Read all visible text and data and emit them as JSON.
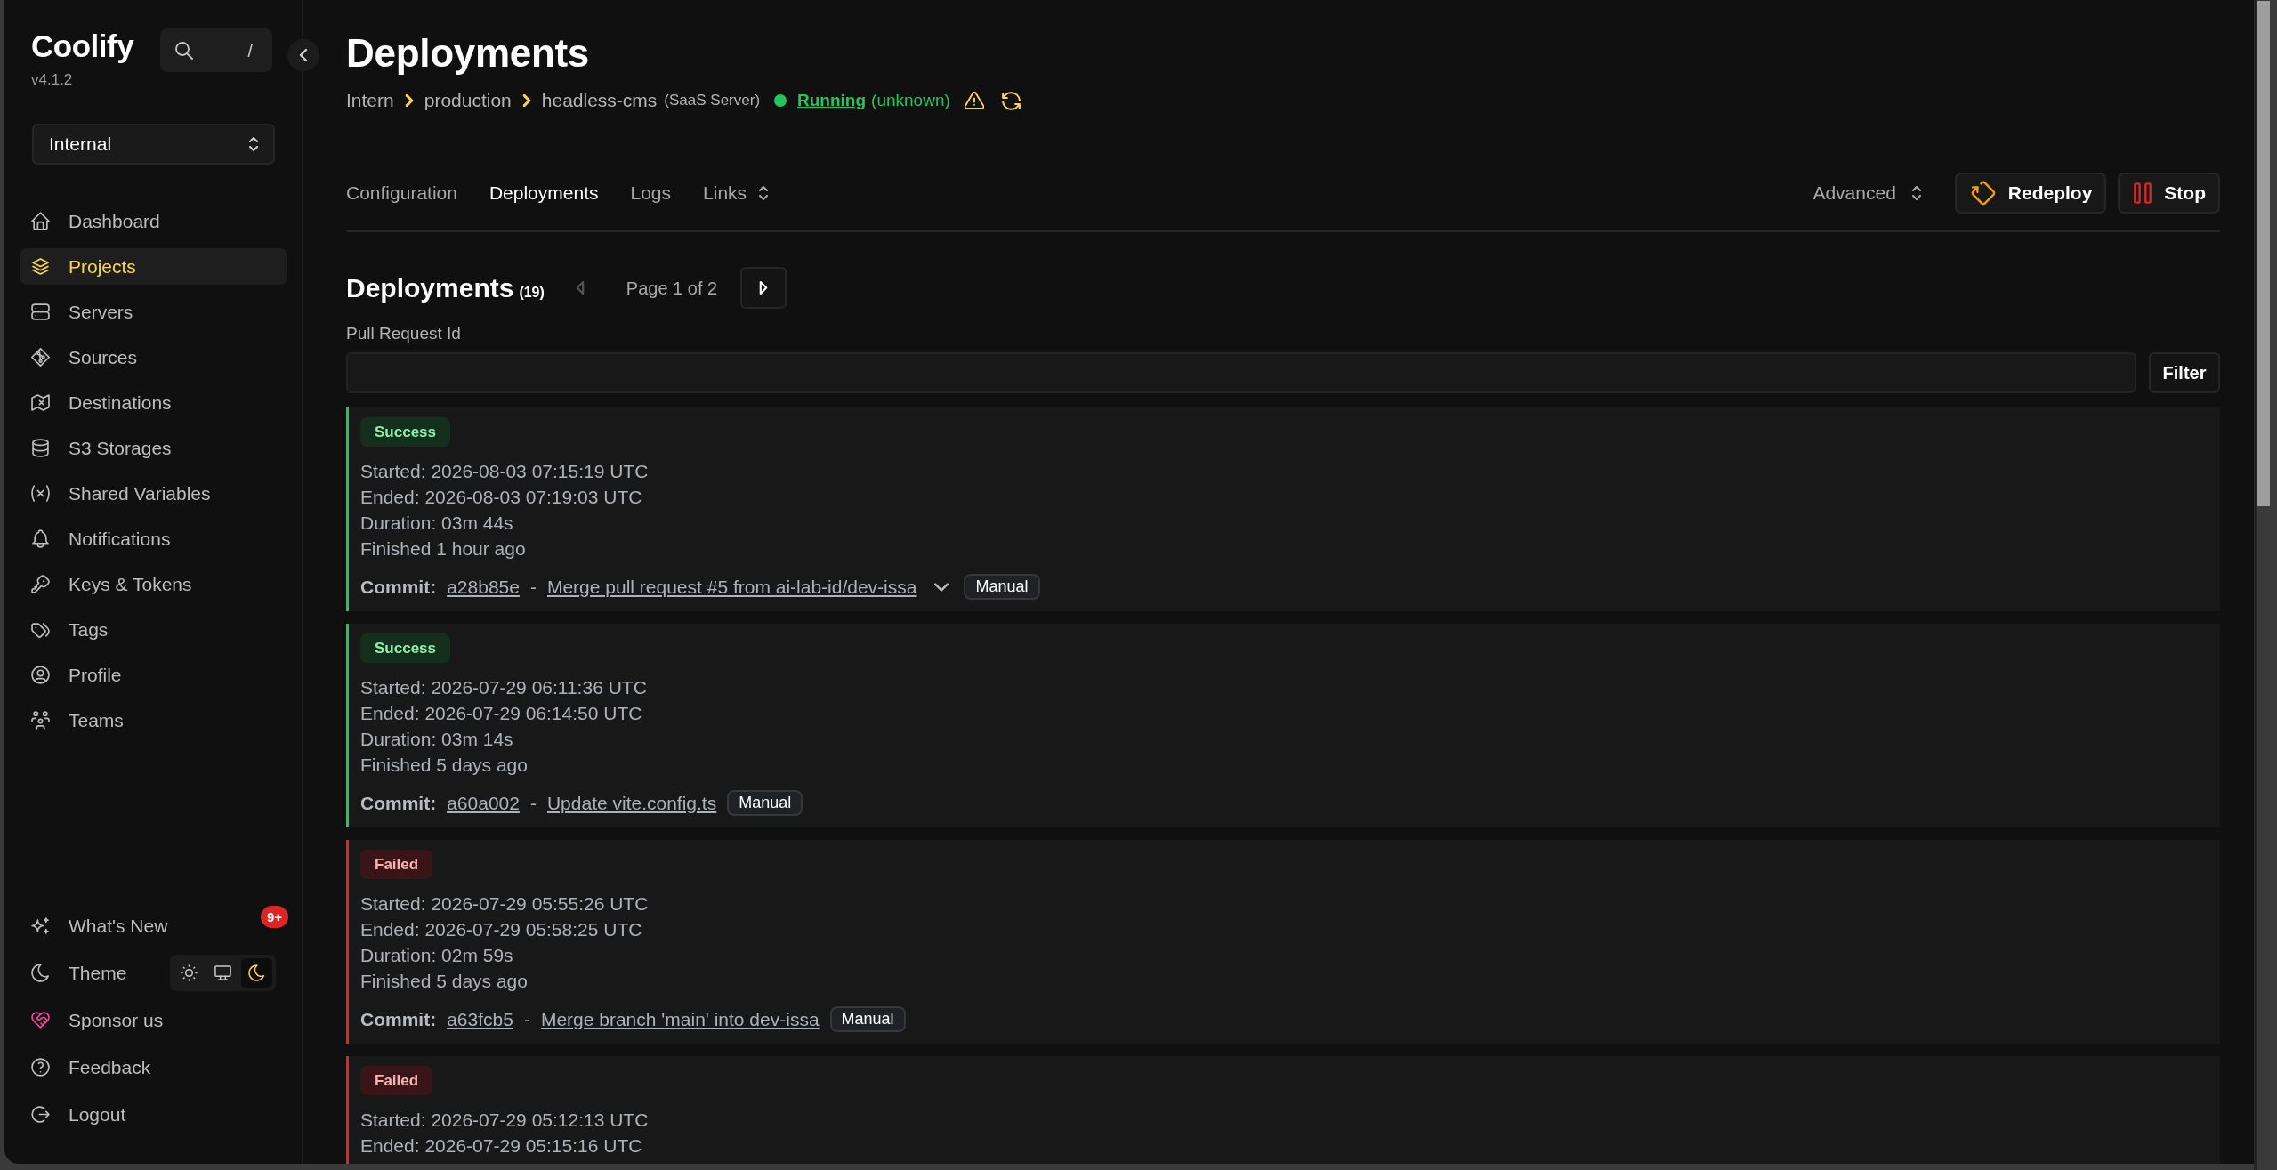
{
  "sidebar": {
    "logo": "Coolify",
    "version": "v4.1.2",
    "search": {
      "shortcut": "/"
    },
    "team_select": {
      "value": "Internal"
    },
    "nav_items": [
      {
        "label": "Dashboard",
        "selected": false
      },
      {
        "label": "Projects",
        "selected": true
      },
      {
        "label": "Servers",
        "selected": false
      },
      {
        "label": "Sources",
        "selected": false
      },
      {
        "label": "Destinations",
        "selected": false
      },
      {
        "label": "S3 Storages",
        "selected": false
      },
      {
        "label": "Shared Variables",
        "selected": false
      },
      {
        "label": "Notifications",
        "selected": false
      },
      {
        "label": "Keys & Tokens",
        "selected": false
      },
      {
        "label": "Tags",
        "selected": false
      },
      {
        "label": "Profile",
        "selected": false
      },
      {
        "label": "Teams",
        "selected": false
      }
    ],
    "footer_items": [
      {
        "label": "What's New",
        "kind": "link",
        "badge": "9+"
      },
      {
        "label": "Theme",
        "kind": "theme",
        "options": [
          {
            "selected": false
          },
          {
            "selected": false
          },
          {
            "selected": true
          }
        ]
      },
      {
        "label": "Sponsor us",
        "kind": "link"
      },
      {
        "label": "Feedback",
        "kind": "link"
      },
      {
        "label": "Logout",
        "kind": "link"
      }
    ]
  },
  "header": {
    "title": "Deployments",
    "breadcrumb": [
      "Intern",
      "production",
      "headless-cms"
    ],
    "server": "(SaaS Server)",
    "status": "Running",
    "status_detail": "(unknown)"
  },
  "tabs": [
    {
      "label": "Configuration",
      "kind": "link",
      "selected": false
    },
    {
      "label": "Deployments",
      "kind": "link",
      "selected": true
    },
    {
      "label": "Logs",
      "kind": "link",
      "selected": false
    },
    {
      "label": "Links",
      "kind": "menu",
      "selected": false
    }
  ],
  "actions": {
    "menu": "Advanced",
    "buttons": [
      {
        "label": "Redeploy"
      },
      {
        "label": "Stop"
      }
    ]
  },
  "deployments": {
    "title": "Deployments",
    "count": "(19)",
    "pager": {
      "text": "Page 1 of 2",
      "prev": {
        "disabled": true
      },
      "next": {
        "disabled": false
      }
    },
    "filter": {
      "label": "Pull Request Id",
      "button": "Filter"
    },
    "items": [
      {
        "status": "Success",
        "kind": "success",
        "lines": [
          "Started: 2026-08-03 07:15:19 UTC",
          "Ended: 2026-08-03 07:19:03 UTC",
          "Duration: 03m 44s",
          "Finished 1 hour ago"
        ],
        "commit": {
          "label": "Commit:",
          "hash": "a28b85e",
          "separator": "-",
          "message": "Merge pull request #5 from ai-lab-id/dev-issa",
          "expandable": true,
          "trigger": "Manual"
        }
      },
      {
        "status": "Success",
        "kind": "success",
        "lines": [
          "Started: 2026-07-29 06:11:36 UTC",
          "Ended: 2026-07-29 06:14:50 UTC",
          "Duration: 03m 14s",
          "Finished 5 days ago"
        ],
        "commit": {
          "label": "Commit:",
          "hash": "a60a002",
          "separator": "-",
          "message": "Update vite.config.ts",
          "expandable": false,
          "trigger": "Manual"
        }
      },
      {
        "status": "Failed",
        "kind": "failed",
        "lines": [
          "Started: 2026-07-29 05:55:26 UTC",
          "Ended: 2026-07-29 05:58:25 UTC",
          "Duration: 02m 59s",
          "Finished 5 days ago"
        ],
        "commit": {
          "label": "Commit:",
          "hash": "a63fcb5",
          "separator": "-",
          "message": "Merge branch 'main' into dev-issa",
          "expandable": false,
          "trigger": "Manual"
        }
      },
      {
        "status": "Failed",
        "kind": "failed",
        "lines": [
          "Started: 2026-07-29 05:12:13 UTC",
          "Ended: 2026-07-29 05:15:16 UTC"
        ]
      }
    ]
  }
}
